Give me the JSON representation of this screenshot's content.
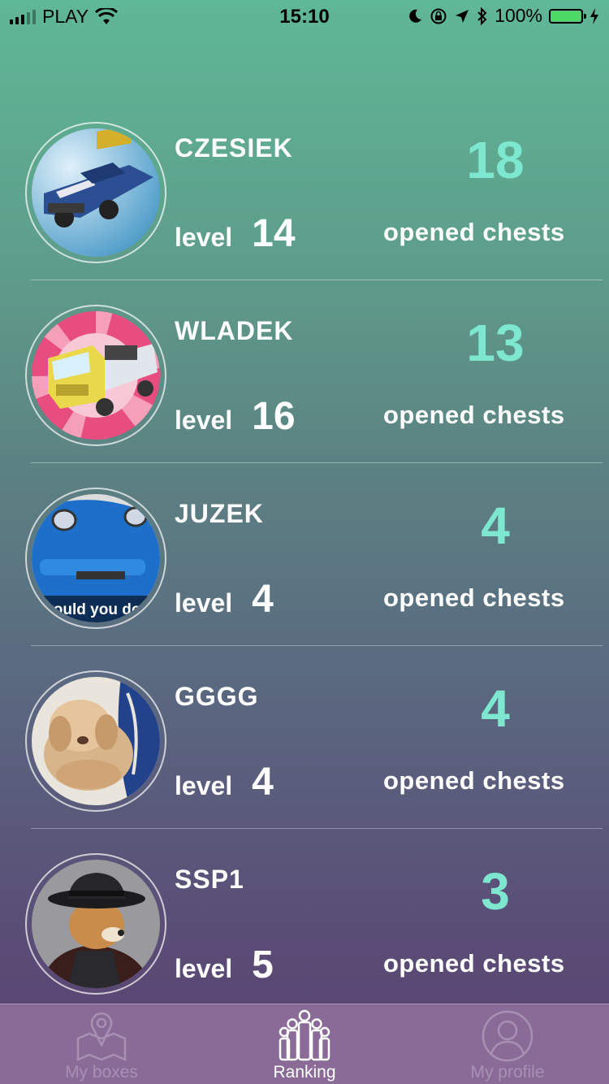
{
  "status": {
    "carrier": "PLAY",
    "time": "15:10",
    "battery": "100%"
  },
  "players": [
    {
      "name": "CZESIEK",
      "level_label": "level",
      "level": "14",
      "chests": "18",
      "chests_label": "opened chests",
      "avatar": "blue-car-avatar"
    },
    {
      "name": "WLADEK",
      "level_label": "level",
      "level": "16",
      "chests": "13",
      "chests_label": "opened chests",
      "avatar": "yellow-truck-avatar"
    },
    {
      "name": "JUZEK",
      "level_label": "level",
      "level": "4",
      "chests": "4",
      "chests_label": "opened chests",
      "avatar": "blue-car-meme-avatar",
      "avatar_caption": "would you do th"
    },
    {
      "name": "GGGG",
      "level_label": "level",
      "level": "4",
      "chests": "4",
      "chests_label": "opened chests",
      "avatar": "puppy-avatar"
    },
    {
      "name": "SSP1",
      "level_label": "level",
      "level": "5",
      "chests": "3",
      "chests_label": "opened chests",
      "avatar": "dog-in-hat-avatar"
    }
  ],
  "tabs": [
    {
      "label": "My boxes",
      "icon": "map-pin-icon",
      "active": false
    },
    {
      "label": "Ranking",
      "icon": "people-group-icon",
      "active": true
    },
    {
      "label": "My profile",
      "icon": "user-profile-icon",
      "active": false
    }
  ],
  "colors": {
    "accent": "#7de8cf",
    "tabbar": "#8a6b98",
    "gradient_top": "#5fb897",
    "gradient_bottom": "#5b3f70"
  }
}
